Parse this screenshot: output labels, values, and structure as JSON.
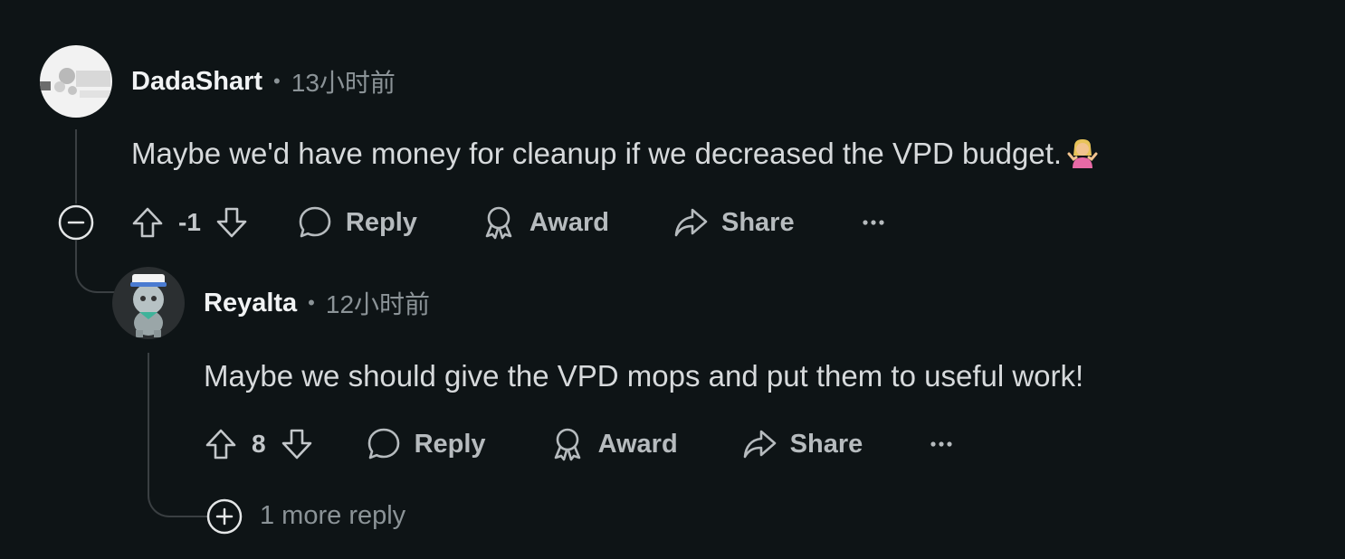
{
  "comments": [
    {
      "author": "DadaShart",
      "separator": "•",
      "time": "13小时前",
      "body": "Maybe we'd have money for cleanup if we decreased the VPD budget.",
      "emoji": "woman-shrugging-emoji",
      "score": "-1",
      "actions": {
        "reply": "Reply",
        "award": "Award",
        "share": "Share",
        "more": "more-options-icon"
      }
    },
    {
      "author": "Reyalta",
      "separator": "•",
      "time": "12小时前",
      "body": "Maybe we should give the VPD mops and put them to useful work!",
      "score": "8",
      "actions": {
        "reply": "Reply",
        "award": "Award",
        "share": "Share",
        "more": "more-options-icon"
      }
    }
  ],
  "more_replies": "1 more reply",
  "colors": {
    "background": "#0e1416",
    "text": "#d7dadc",
    "muted": "#8b9397",
    "thread_line": "#3a3f42"
  }
}
